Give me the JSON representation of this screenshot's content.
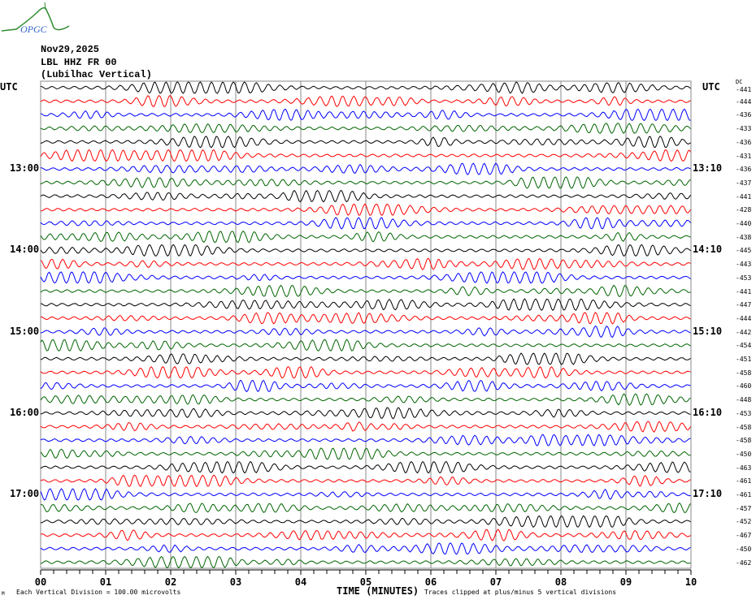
{
  "logo_text": "OPGC",
  "header": {
    "date": "Nov29,2025",
    "station": "LBL HHZ FR 00",
    "location": "(Lubilhac Vertical)"
  },
  "left_axis_label": "UTC",
  "right_axis_label": "UTC",
  "dc_label": "DC",
  "chart_data": {
    "type": "line",
    "xlabel": "TIME (MINUTES)",
    "x_ticks": [
      "00",
      "01",
      "02",
      "03",
      "04",
      "05",
      "06",
      "07",
      "08",
      "09",
      "10"
    ],
    "xlim": [
      0,
      10
    ],
    "grid": true,
    "trace_colors": [
      "#000000",
      "#ff0000",
      "#0000ff",
      "#006400"
    ],
    "left_time_labels": [
      {
        "row": 6,
        "label": "13:00"
      },
      {
        "row": 12,
        "label": "14:00"
      },
      {
        "row": 18,
        "label": "15:00"
      },
      {
        "row": 24,
        "label": "16:00"
      },
      {
        "row": 30,
        "label": "17:00"
      }
    ],
    "right_time_labels": [
      {
        "row": 6,
        "label": "13:10"
      },
      {
        "row": 12,
        "label": "14:10"
      },
      {
        "row": 18,
        "label": "15:10"
      },
      {
        "row": 24,
        "label": "16:10"
      },
      {
        "row": 30,
        "label": "17:10"
      }
    ],
    "dc_offsets": [
      "-441",
      "-444",
      "-436",
      "-433",
      "-436",
      "-431",
      "-436",
      "-437",
      "-441",
      "-428",
      "-440",
      "-438",
      "-445",
      "-443",
      "-453",
      "-441",
      "-447",
      "-444",
      "-442",
      "-454",
      "-451",
      "-458",
      "-460",
      "-448",
      "-453",
      "-458",
      "-458",
      "-450",
      "-463",
      "-461",
      "-461",
      "-457",
      "-452",
      "-467",
      "-450",
      "-462"
    ]
  },
  "footer": {
    "scale": "Each Vertical Division =  100.00 microvolts",
    "clip_note": "Traces clipped at plus/minus 5 vertical divisions"
  }
}
